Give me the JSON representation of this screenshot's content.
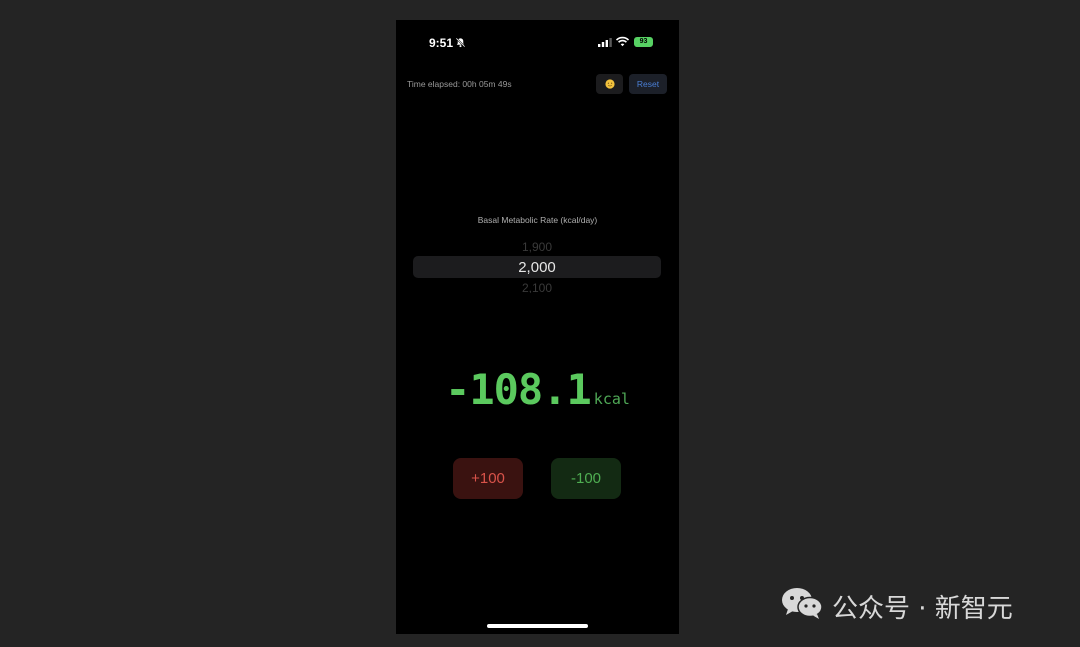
{
  "status_bar": {
    "time": "9:51",
    "battery": "93"
  },
  "header": {
    "elapsed": "Time elapsed: 00h 05m 49s",
    "reset_label": "Reset"
  },
  "bmr": {
    "label": "Basal Metabolic Rate (kcal/day)",
    "prev": "1,900",
    "current": "2,000",
    "next": "2,100"
  },
  "readout": {
    "value": "-108.1",
    "unit": "kcal"
  },
  "buttons": {
    "plus_label": "+100",
    "minus_label": "-100"
  },
  "watermark": {
    "text": "公众号 · 新智元"
  },
  "colors": {
    "background": "#242424",
    "screen": "#000000",
    "accent_green": "#5bc95e",
    "accent_red": "#d9534a",
    "accent_blue": "#4a7fd6"
  },
  "icons": [
    "bell-slash-icon",
    "signal-icon",
    "wifi-icon",
    "battery-icon",
    "emoji-face-icon",
    "wechat-icon"
  ]
}
